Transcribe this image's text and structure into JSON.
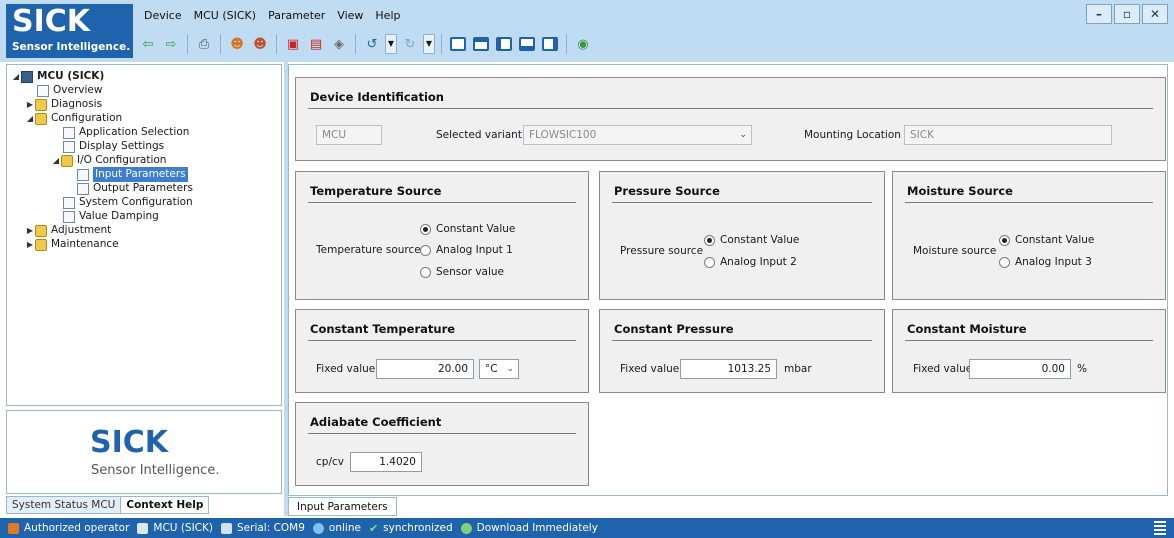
{
  "brand": {
    "word": "SICK",
    "tagline": "Sensor Intelligence.",
    "tagline_panel": "Sensor Intelligence."
  },
  "menu": [
    "Device",
    "MCU (SICK)",
    "Parameter",
    "View",
    "Help"
  ],
  "window_controls": {
    "minimize": "–",
    "restore": "▫",
    "close": "✕"
  },
  "toolbar": [
    "back-icon",
    "forward-icon",
    "print-icon",
    "user-icon",
    "users-icon",
    "pdf-icon",
    "clipboard-icon",
    "eraser-icon",
    "undo-icon",
    "redo-icon",
    "layout-full-icon",
    "layout-split-h-icon",
    "layout-split-v-icon",
    "layout-bottom-icon",
    "layout-grid-icon",
    "help-icon"
  ],
  "tree": {
    "root": "MCU (SICK)",
    "items": [
      {
        "label": "Overview"
      },
      {
        "label": "Diagnosis"
      },
      {
        "label": "Configuration"
      },
      {
        "label": "Application Selection"
      },
      {
        "label": "Display Settings"
      },
      {
        "label": "I/O Configuration"
      },
      {
        "label": "Input Parameters"
      },
      {
        "label": "Output Parameters"
      },
      {
        "label": "System Configuration"
      },
      {
        "label": "Value Damping"
      },
      {
        "label": "Adjustment"
      },
      {
        "label": "Maintenance"
      }
    ]
  },
  "left_tabs": [
    "System Status MCU",
    "Context Help"
  ],
  "device_identification": {
    "title": "Device Identification",
    "device_value": "MCU",
    "variant_label": "Selected variant",
    "variant_value": "FLOWSIC100",
    "mounting_label": "Mounting Location",
    "mounting_value": "SICK"
  },
  "temperature_source": {
    "title": "Temperature Source",
    "label": "Temperature source",
    "options": [
      "Constant Value",
      "Analog Input 1",
      "Sensor value"
    ],
    "selected": "Constant Value"
  },
  "pressure_source": {
    "title": "Pressure Source",
    "label": "Pressure source",
    "options": [
      "Constant Value",
      "Analog Input 2"
    ],
    "selected": "Constant Value"
  },
  "moisture_source": {
    "title": "Moisture Source",
    "label": "Moisture source",
    "options": [
      "Constant Value",
      "Analog Input 3"
    ],
    "selected": "Constant Value"
  },
  "constant_temperature": {
    "title": "Constant Temperature",
    "label": "Fixed value",
    "value": "20.00",
    "unit": "°C"
  },
  "constant_pressure": {
    "title": "Constant Pressure",
    "label": "Fixed value",
    "value": "1013.25",
    "unit": "mbar"
  },
  "constant_moisture": {
    "title": "Constant Moisture",
    "label": "Fixed value",
    "value": "0.00",
    "unit": "%"
  },
  "adiabate": {
    "title": "Adiabate Coefficient",
    "label": "cp/cv",
    "value": "1.4020"
  },
  "main_tabs": [
    "Input Parameters"
  ],
  "status": {
    "user": "Authorized operator",
    "device": "MCU (SICK)",
    "serial": "Serial: COM9",
    "online": "online",
    "sync": "synchronized",
    "download": "Download Immediately"
  },
  "colors": {
    "brand_blue": "#1f63ad",
    "titlebar": "#bfdcf3",
    "selection": "#3d7ed1"
  }
}
